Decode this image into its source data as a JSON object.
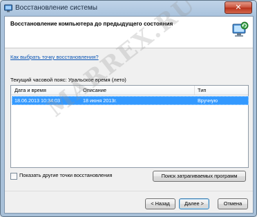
{
  "window": {
    "title": "Восстановление системы",
    "close_symbol": "✕"
  },
  "header": {
    "title": "Восстановление компьютера до предыдущего состояния",
    "icon": "system-restore-icon"
  },
  "link": {
    "text": "Как выбрать точку восстановления?"
  },
  "timezone": {
    "text": "Текущий часовой пояс: Уральское время (лето)"
  },
  "table": {
    "columns": [
      "Дата и время",
      "Описание",
      "Тип"
    ],
    "rows": [
      {
        "date": "18.06.2013 10:34:03",
        "description": "18 июня 2013г.",
        "type": "Вручную",
        "selected": true
      }
    ]
  },
  "checkbox": {
    "label": "Показать другие точки восстановления",
    "checked": false
  },
  "buttons": {
    "scan": "Поиск затрагиваемых программ",
    "back": "< Назад",
    "next": "Далее >",
    "cancel": "Отмена"
  },
  "watermark": {
    "text": "MARREX.RU"
  },
  "colors": {
    "selection": "#3399ff",
    "link": "#0b55b5",
    "close": "#c9513b"
  }
}
